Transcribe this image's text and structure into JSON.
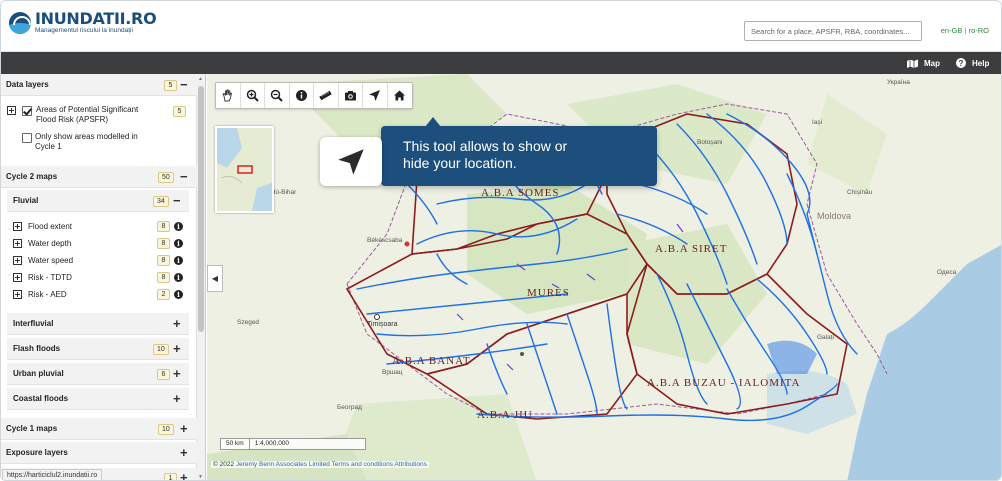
{
  "header": {
    "logo_title": "INUNDATII.RO",
    "logo_subtitle": "Managementul riscului la inundații",
    "search_placeholder": "Search for a place, APSFR, RBA, coordinates...",
    "lang_en": "en-GB",
    "lang_sep": "|",
    "lang_ro": "ro-RO"
  },
  "topbar": {
    "map_label": "Map",
    "map_icon": "map-icon",
    "help_label": "Help",
    "help_icon": "question-circle-icon"
  },
  "sidebar": {
    "data_layers": {
      "label": "Data layers",
      "count": "5",
      "toggle": "−"
    },
    "apsfr": {
      "label_line1": "Areas of Potential Significant",
      "label_line2": "Flood Risk (APSFR)",
      "count": "5",
      "checked": true
    },
    "only_modelled": {
      "label_line1": "Only show areas modelled in",
      "label_line2": "Cycle 1",
      "checked": false
    },
    "cycle2": {
      "label": "Cycle 2 maps",
      "count": "50",
      "toggle": "−"
    },
    "fluvial": {
      "label": "Fluvial",
      "count": "34",
      "toggle": "−"
    },
    "fluvial_layers": [
      {
        "label": "Flood extent",
        "count": "8"
      },
      {
        "label": "Water depth",
        "count": "8"
      },
      {
        "label": "Water speed",
        "count": "8"
      },
      {
        "label": "Risk - TDTD",
        "count": "8"
      },
      {
        "label": "Risk - AED",
        "count": "2"
      }
    ],
    "interfluvial": {
      "label": "Interfluvial",
      "toggle": "+"
    },
    "flash_floods": {
      "label": "Flash floods",
      "count": "10",
      "toggle": "+"
    },
    "urban_pluvial": {
      "label": "Urban pluvial",
      "count": "6",
      "toggle": "+"
    },
    "coastal_floods": {
      "label": "Coastal floods",
      "toggle": "+"
    },
    "cycle1": {
      "label": "Cycle 1 maps",
      "count": "10",
      "toggle": "+"
    },
    "exposure": {
      "label": "Exposure layers",
      "toggle": "+"
    },
    "partial_count": "1"
  },
  "map": {
    "tools": [
      "pan-hand-icon",
      "zoom-in-icon",
      "zoom-out-icon",
      "info-icon",
      "measure-ruler-icon",
      "camera-icon",
      "location-arrow-icon",
      "home-icon"
    ],
    "tooltip_text": "This tool allows to show or hide your location.",
    "scale_km": "50 km",
    "scale_ratio": "1:4,000,000",
    "attribution_prefix": "© 2022",
    "attribution_jba": "Jeremy Benn Associates Limited",
    "attribution_terms": "Terms and conditions",
    "attribution_attributions": "Attributions",
    "labels": {
      "somes": "A.B.A SOMES",
      "siret": "A.B.A SIRET",
      "mures": "MURES",
      "banat": "A.B.A BANAT",
      "buzau": "A.B.A BUZAU - IALOMITA",
      "jiu": "A.B.A JIU",
      "timisoara": "Timișoara",
      "bekescsaba": "Békéscsaba",
      "szeged": "Szeged",
      "beograd": "Београд",
      "vrsac": "Вршац",
      "moldova": "Moldova",
      "odesa": "Одеса",
      "ukraine": "Україна",
      "iasi": "Iași",
      "hajdu": "Hajdú-Bihar",
      "botosani": "Botoșani",
      "galati": "Galați",
      "chisinau": "Chișinău"
    }
  },
  "status_url": "https://harticiclul2.inundatii.ro",
  "colors": {
    "brand": "#1b4e7a",
    "topbar": "#3c3d3e",
    "tooltip": "#1d4f7d",
    "river": "#1f6fe5",
    "basin": "#8b1d1d"
  }
}
